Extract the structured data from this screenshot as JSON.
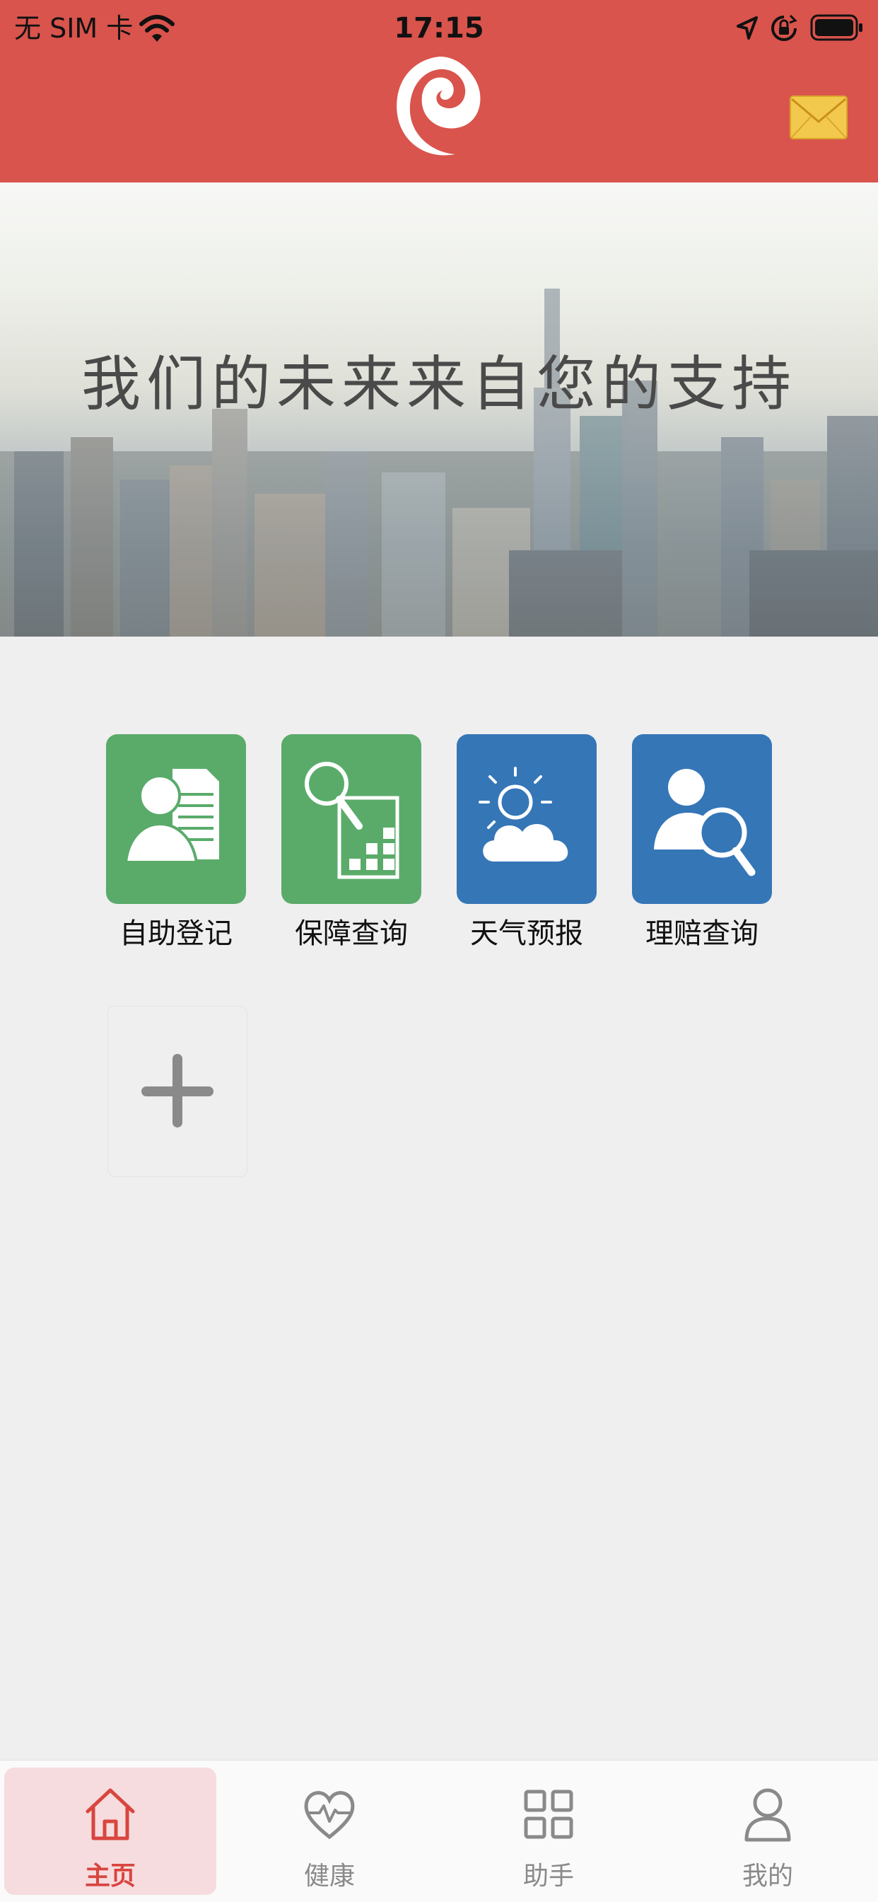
{
  "status_bar": {
    "carrier": "无 SIM 卡",
    "time": "17:15"
  },
  "header": {
    "logo_icon": "swirl-logo-icon",
    "mail_icon": "envelope-icon",
    "color": "#d9544c"
  },
  "banner": {
    "slogan": "我们的未来来自您的支持"
  },
  "services": [
    {
      "label": "自助登记",
      "icon": "user-document-icon",
      "color": "#5aab6a"
    },
    {
      "label": "保障查询",
      "icon": "search-chart-icon",
      "color": "#5aab6a"
    },
    {
      "label": "天气预报",
      "icon": "sun-cloud-icon",
      "color": "#3576b7"
    },
    {
      "label": "理赔查询",
      "icon": "user-search-icon",
      "color": "#3576b7"
    }
  ],
  "add_tile": {
    "icon": "plus-icon"
  },
  "tabbar": {
    "tabs": [
      {
        "label": "主页",
        "icon": "home-icon",
        "active": true
      },
      {
        "label": "健康",
        "icon": "heart-pulse-icon",
        "active": false
      },
      {
        "label": "助手",
        "icon": "grid-icon",
        "active": false
      },
      {
        "label": "我的",
        "icon": "person-icon",
        "active": false
      }
    ],
    "active_color": "#d9453f"
  }
}
